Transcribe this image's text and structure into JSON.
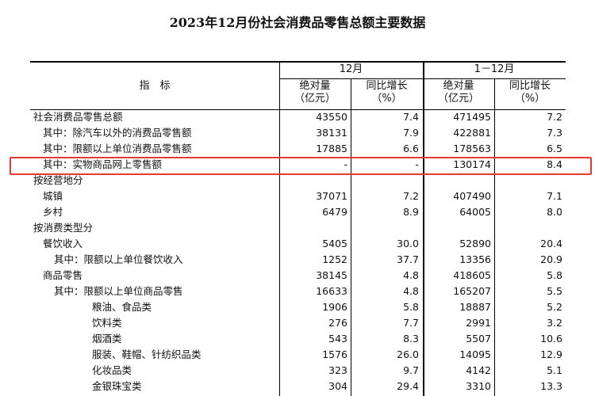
{
  "title": "2023年12月份社会消费品零售总额主要数据",
  "header": {
    "indicator": "指　标",
    "period_dec": "12月",
    "period_ytd": "1－12月",
    "abs_label_1": "绝对量",
    "abs_label_2": "（亿元）",
    "yoy_label_1": "同比增长",
    "yoy_label_2": "（%）"
  },
  "rows": [
    {
      "name": "社会消费品零售总额",
      "dec_abs": "43550",
      "dec_yoy": "7.4",
      "ytd_abs": "471495",
      "ytd_yoy": "7.2"
    },
    {
      "name": "其中：除汽车以外的消费品零售额",
      "dec_abs": "38131",
      "dec_yoy": "7.9",
      "ytd_abs": "422881",
      "ytd_yoy": "7.3"
    },
    {
      "name": "其中：限额以上单位消费品零售额",
      "dec_abs": "17885",
      "dec_yoy": "6.6",
      "ytd_abs": "178563",
      "ytd_yoy": "6.5"
    },
    {
      "name": "其中：实物商品网上零售额",
      "dec_abs": "-",
      "dec_yoy": "-",
      "ytd_abs": "130174",
      "ytd_yoy": "8.4"
    },
    {
      "name": "按经营地分",
      "dec_abs": "",
      "dec_yoy": "",
      "ytd_abs": "",
      "ytd_yoy": ""
    },
    {
      "name": "城镇",
      "dec_abs": "37071",
      "dec_yoy": "7.2",
      "ytd_abs": "407490",
      "ytd_yoy": "7.1"
    },
    {
      "name": "乡村",
      "dec_abs": "6479",
      "dec_yoy": "8.9",
      "ytd_abs": "64005",
      "ytd_yoy": "8.0"
    },
    {
      "name": "按消费类型分",
      "dec_abs": "",
      "dec_yoy": "",
      "ytd_abs": "",
      "ytd_yoy": ""
    },
    {
      "name": "餐饮收入",
      "dec_abs": "5405",
      "dec_yoy": "30.0",
      "ytd_abs": "52890",
      "ytd_yoy": "20.4"
    },
    {
      "name": "其中：限额以上单位餐饮收入",
      "dec_abs": "1252",
      "dec_yoy": "37.7",
      "ytd_abs": "13356",
      "ytd_yoy": "20.9"
    },
    {
      "name": "商品零售",
      "dec_abs": "38145",
      "dec_yoy": "4.8",
      "ytd_abs": "418605",
      "ytd_yoy": "5.8"
    },
    {
      "name": "其中：限额以上单位商品零售",
      "dec_abs": "16633",
      "dec_yoy": "4.8",
      "ytd_abs": "165207",
      "ytd_yoy": "5.5"
    },
    {
      "name": "粮油、食品类",
      "dec_abs": "1906",
      "dec_yoy": "5.8",
      "ytd_abs": "18887",
      "ytd_yoy": "5.2"
    },
    {
      "name": "饮料类",
      "dec_abs": "276",
      "dec_yoy": "7.7",
      "ytd_abs": "2991",
      "ytd_yoy": "3.2"
    },
    {
      "name": "烟酒类",
      "dec_abs": "543",
      "dec_yoy": "8.3",
      "ytd_abs": "5507",
      "ytd_yoy": "10.6"
    },
    {
      "name": "服装、鞋帽、针纺织品类",
      "dec_abs": "1576",
      "dec_yoy": "26.0",
      "ytd_abs": "14095",
      "ytd_yoy": "12.9"
    },
    {
      "name": "化妆品类",
      "dec_abs": "323",
      "dec_yoy": "9.7",
      "ytd_abs": "4142",
      "ytd_yoy": "5.1"
    },
    {
      "name": "金银珠宝类",
      "dec_abs": "304",
      "dec_yoy": "29.4",
      "ytd_abs": "3310",
      "ytd_yoy": "13.3"
    }
  ]
}
